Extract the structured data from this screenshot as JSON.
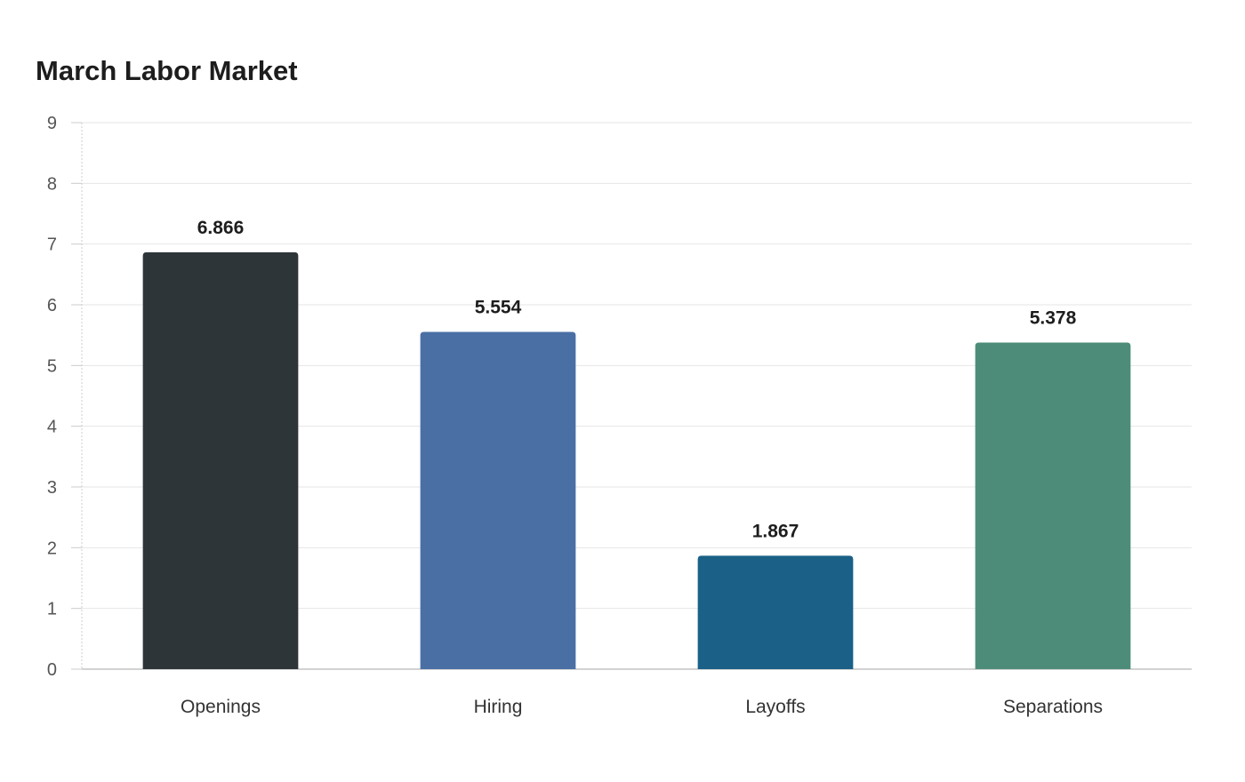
{
  "chart_data": {
    "type": "bar",
    "title": "March Labor Market",
    "xlabel": "",
    "ylabel": "",
    "categories": [
      "Openings",
      "Hiring",
      "Layoffs",
      "Separations"
    ],
    "values": [
      6.866,
      5.554,
      1.867,
      5.378
    ],
    "value_labels": [
      "6.866",
      "5.554",
      "1.867",
      "5.378"
    ],
    "colors": [
      "#2d3538",
      "#4a6fa5",
      "#1a6087",
      "#4e8c7a"
    ],
    "ylim": [
      0,
      9
    ],
    "yticks": [
      0,
      1,
      2,
      3,
      4,
      5,
      6,
      7,
      8,
      9
    ],
    "grid": true,
    "legend": "none"
  }
}
